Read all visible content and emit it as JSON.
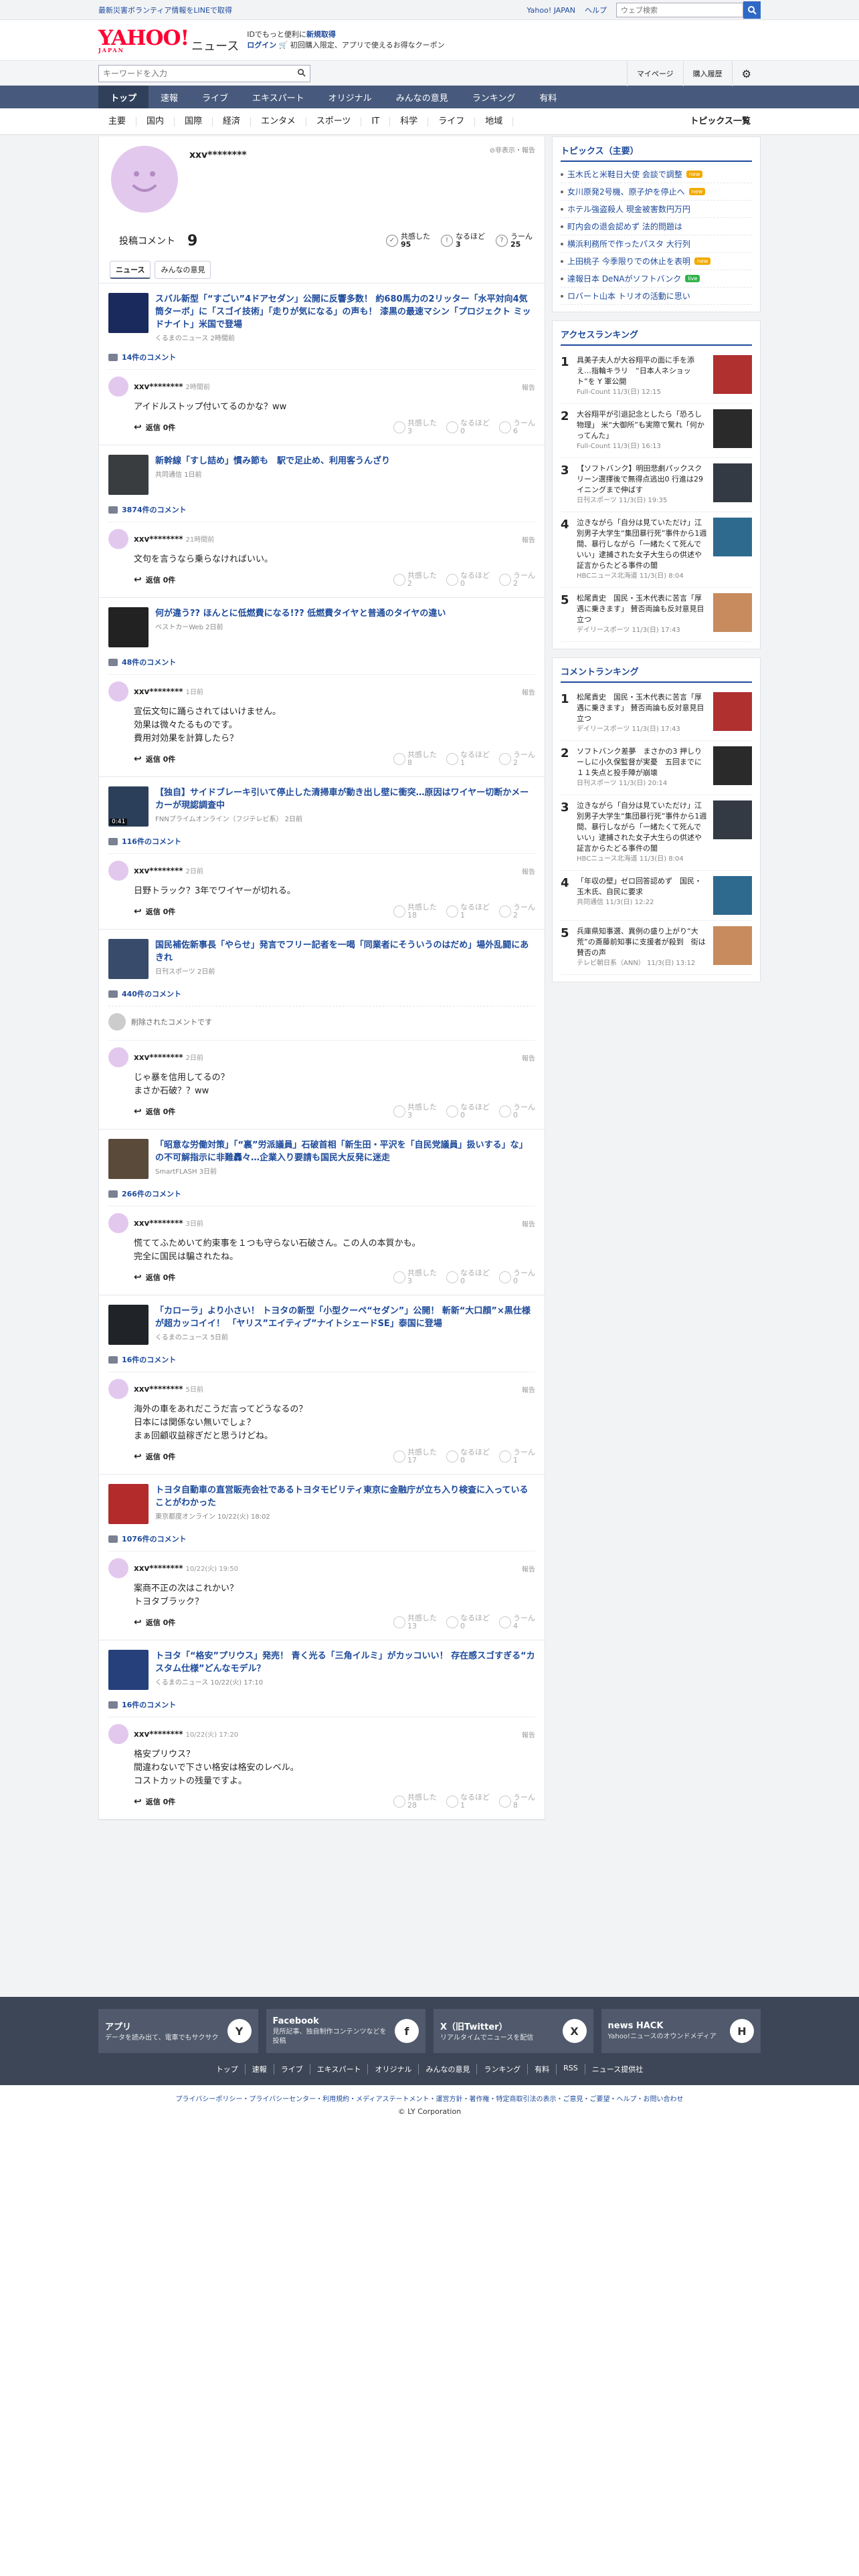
{
  "topbar": {
    "left": "最新災害ボランティア情報をLINEで取得",
    "links": [
      "Yahoo! JAPAN",
      "ヘルプ"
    ],
    "search_placeholder": "ウェブ検索"
  },
  "header": {
    "logo": "YAHOO!",
    "logo_sub": "JAPAN",
    "logo_news": "ニュース",
    "promo_l1": "IDでもっと便利に",
    "promo_l1b": "新規取得",
    "promo_l2": "ログイン",
    "promo_l3": "初回購入限定、アプリで使えるお得なクーポン"
  },
  "searchrow": {
    "placeholder": "キーワードを入力",
    "links": [
      "マイページ",
      "購入履歴"
    ]
  },
  "nav": {
    "items": [
      "トップ",
      "速報",
      "ライブ",
      "エキスパート",
      "オリジナル",
      "みんなの意見",
      "ランキング",
      "有料"
    ]
  },
  "cats": {
    "items": [
      "主要",
      "国内",
      "国際",
      "経済",
      "エンタメ",
      "スポーツ",
      "IT",
      "科学",
      "ライフ",
      "地域"
    ],
    "all": "トピックス一覧"
  },
  "profile": {
    "name": "xxv********",
    "notice": "非表示・報告",
    "count_label": "投稿コメント",
    "count": "9",
    "reactions": [
      {
        "l1": "共感した",
        "l2": "95"
      },
      {
        "l1": "なるほど",
        "l2": "3"
      },
      {
        "l1": "うーん",
        "l2": "25"
      }
    ]
  },
  "tabs": [
    "ニュース",
    "みんなの意見"
  ],
  "labels": {
    "reply": "返信 0件",
    "report": "報告",
    "v1": "共感した",
    "v2": "なるほど",
    "v3": "うーん",
    "deleted": "削除されたコメントです"
  },
  "entries": [
    {
      "title": "スバル新型「“すごい”4ドアセダン」公開に反響多数！ 約680馬力の2リッター「水平対向4気筒ターボ」に「スゴイ技術」「走りが気になる」の声も！ 漆黒の最速マシン「プロジェクト ミッドナイト」米国で登場",
      "src": "くるまのニュース 2時間前",
      "ccount": "14件のコメント",
      "comments": [
        {
          "name": "xxv********",
          "time": "2時間前",
          "body": [
            "アイドルストップ付いてるのかな？ww"
          ],
          "v": [
            "3",
            "0",
            "6"
          ]
        }
      ]
    },
    {
      "title": "新幹線「すし詰め」慣み節も　駅で足止め、利用客うんざり",
      "src": "共同通信 1日前",
      "ccount": "3874件のコメント",
      "comments": [
        {
          "name": "xxv********",
          "time": "21時間前",
          "body": [
            "文句を言うなら乗らなければいい。"
          ],
          "v": [
            "2",
            "0",
            "2"
          ]
        }
      ]
    },
    {
      "title": "何が違う?? ほんとに低燃費になる!?? 低燃費タイヤと普通のタイヤの違い",
      "src": "ベストカーWeb 2日前",
      "ccount": "48件のコメント",
      "comments": [
        {
          "name": "xxv********",
          "time": "1日前",
          "body": [
            "宣伝文句に踊らされてはいけません。",
            "効果は微々たるものです。",
            "費用対効果を計算したら？"
          ],
          "v": [
            "8",
            "1",
            "2"
          ]
        }
      ]
    },
    {
      "title": "【独自】サイドブレーキ引いて停止した清掃車が動き出し壁に衝突…原因はワイヤー切断かメーカーが現認調査中",
      "src": "FNNプライムオンライン（フジテレビ系） 2日前",
      "ccount": "116件のコメント",
      "dur": "0:41",
      "comments": [
        {
          "name": "xxv********",
          "time": "2日前",
          "body": [
            "日野トラック？3年でワイヤーが切れる。"
          ],
          "v": [
            "18",
            "1",
            "2"
          ]
        }
      ]
    },
    {
      "title": "国民補佐新事長「やらせ」発言でフリー記者を一喝「同業者にそういうのはだめ」場外乱闘にあきれ",
      "src": "日刊スポーツ 2日前",
      "ccount": "440件のコメント",
      "deleted": true,
      "comments": [
        {
          "name": "xxv********",
          "time": "2日前",
          "body": [
            "じゃ暴を信用してるの？",
            "まさか石破？？ww"
          ],
          "v": [
            "3",
            "0",
            "0"
          ]
        }
      ]
    },
    {
      "title": "「昭意な労働対策」「“裏”労派議員」石破首相「新生田・平沢を「自民党議員」扱いする」な」の不可解指示に非難轟々…企業入り要請も国民大反発に迷走",
      "src": "SmartFLASH 3日前",
      "ccount": "266件のコメント",
      "comments": [
        {
          "name": "xxv********",
          "time": "3日前",
          "body": [
            "慌ててふためいて約束事を１つも守らない石破さん。この人の本質かも。",
            "完全に国民は騙されたね。"
          ],
          "v": [
            "3",
            "0",
            "0"
          ]
        }
      ]
    },
    {
      "title": "「カローラ」より小さい！ トヨタの新型「小型クーペ“セダン”」公開！ 斬新“大口顔”×黒仕様が超カッコイイ！ 「ヤリス”エイティブ”ナイトシェードSE」泰国に登場",
      "src": "くるまのニュース 5日前",
      "ccount": "16件のコメント",
      "comments": [
        {
          "name": "xxv********",
          "time": "5日前",
          "body": [
            "海外の車をあれだこうだ言ってどうなるの？",
            "日本には関係ない無いでしょ？",
            "まぁ回顧収益稼ぎだと思うけどね。"
          ],
          "v": [
            "17",
            "0",
            "1"
          ]
        }
      ]
    },
    {
      "title": "トヨタ自動車の直営販売会社であるトヨタモビリティ東京に金融庁が立ち入り検査に入っていることがわかった",
      "src": "東京都度オンライン 10/22(火) 18:02",
      "ccount": "1076件のコメント",
      "comments": [
        {
          "name": "xxv********",
          "time": "10/22(火) 19:50",
          "body": [
            "案商不正の次はこれかい？",
            "トヨタブラック？"
          ],
          "v": [
            "13",
            "0",
            "4"
          ]
        }
      ]
    },
    {
      "title": "トヨタ「“格安”プリウス」発売！ 青く光る「三角イルミ」がカッコいい！ 存在感スゴすぎる“カスタム仕様”どんなモデル？",
      "src": "くるまのニュース 10/22(火) 17:10",
      "ccount": "16件のコメント",
      "comments": [
        {
          "name": "xxv********",
          "time": "10/22(火) 17:20",
          "body": [
            "格安プリウス？",
            "間違わないで下さい格安は格安のレベル。",
            "コストカットの残量ですよ。"
          ],
          "v": [
            "28",
            "1",
            "8"
          ]
        }
      ]
    }
  ],
  "side": {
    "topics_title": "トピックス（主要）",
    "topics": [
      {
        "t": "玉木氏と米鞋日大使 会談で調整",
        "b": "new"
      },
      {
        "t": "女川原発2号機、原子炉を停止へ",
        "b": "new"
      },
      {
        "t": "ホテル強盗殺人 現金被害数円万円",
        "b": ""
      },
      {
        "t": "町内会の退会認めず 法的問題は",
        "b": ""
      },
      {
        "t": "横浜利務所で作ったパスタ 大行列",
        "b": ""
      },
      {
        "t": "上田桃子 今季限りでの休止を表明",
        "b": "new"
      },
      {
        "t": "達報日本 DeNAがソフトバンク",
        "b": "live"
      },
      {
        "t": "ロバート山本 トリオの活動に思い",
        "b": ""
      }
    ],
    "access_title": "アクセスランキング",
    "access": [
      {
        "t": "具美子夫人が大谷翔平の面に手を添え…指輪キラリ　“日本人ネショット”を Y 軍公開",
        "s": "Full-Count 11/3(日) 12:15"
      },
      {
        "t": "大谷翔平が引退記念としたら「恐ろし物理」 米“大御所”も実際で驚れ「何かってんた」",
        "s": "Full-Count 11/3(日) 16:13"
      },
      {
        "t": "【ソフトバンク】明田悲劇パックスクリーン選擇後で無得点逃出0 行進は29イニングまで伸ばす",
        "s": "日刊スポーツ 11/3(日) 19:35"
      },
      {
        "t": "泣きながら「自分は見ていただけ」江別男子大学生“集団暴行死”事件から1週間、暴行しながら「一緒たくて死んでいい」逮捕された女子大生らの供述や証言からたどる事件の闇",
        "s": "HBCニュース北海道 11/3(日) 8:04"
      },
      {
        "t": "松尾貴史　国民・玉木代表に苦言「厚遇に乗きます」 賛否両論も反対意見目立つ",
        "s": "デイリースポーツ 11/3(日) 17:43"
      }
    ],
    "comment_title": "コメントランキング",
    "comment": [
      {
        "t": "松尾貴史　国民・玉木代表に苦言「厚遇に乗きます」 賛否両論も反対意見目立つ",
        "s": "デイリースポーツ 11/3(日) 17:43"
      },
      {
        "t": "ソフトバンク差夢　まさかの3 押しりーしに小久保監督が実憂　五回までに１１失点と投手陣が崩壊",
        "s": "日刊スポーツ 11/3(日) 20:14"
      },
      {
        "t": "泣きながら「自分は見ていただけ」江別男子大学生“集団暴行死”事件から1週間、暴行しながら「一緒たくて死んでいい」逮捕された女子大生らの供述や証言からたどる事件の闇",
        "s": "HBCニュース北海道 11/3(日) 8:04"
      },
      {
        "t": "「年収の壁」ゼロ回答認めず　国民・玉木氏、自民に要求",
        "s": "共同通信 11/3(日) 12:22"
      },
      {
        "t": "兵庫県知事選、異例の盛り上がり“大荒”の斎藤前知事に支援者が殺到　街は賛否の声",
        "s": "テレビ朝日系（ANN） 11/3(日) 13:12"
      }
    ]
  },
  "footer": {
    "apps": [
      {
        "title": "アプリ",
        "desc": "データを読み出て、電車でもサクサク",
        "icon": "Y"
      },
      {
        "title": "Facebook",
        "desc": "見所記事、独自制作コンテンツなどを投稿",
        "icon": "f"
      },
      {
        "title": "X（旧Twitter）",
        "desc": "リアルタイムでニュースを配信",
        "icon": "X"
      },
      {
        "title": "news HACK",
        "desc": "Yahoo!ニュースのオウンドメディア",
        "icon": "H"
      }
    ],
    "nav": [
      "トップ",
      "速報",
      "ライブ",
      "エキスパート",
      "オリジナル",
      "みんなの意見",
      "ランキング",
      "有料",
      "RSS",
      "ニュース提供社"
    ],
    "legal": "プライバシーポリシー・プライバシーセンター・利用規約・メディアステートメント・運営方針・著作権・特定商取引法の表示・ご意見・ご要望・ヘルプ・お問い合わせ",
    "copy": "© LY Corporation"
  },
  "colors": {
    "accent": "#1d4a9b",
    "nav": "#475a7d",
    "brand": "#ff0033",
    "avatar": "#e3c8ee"
  }
}
